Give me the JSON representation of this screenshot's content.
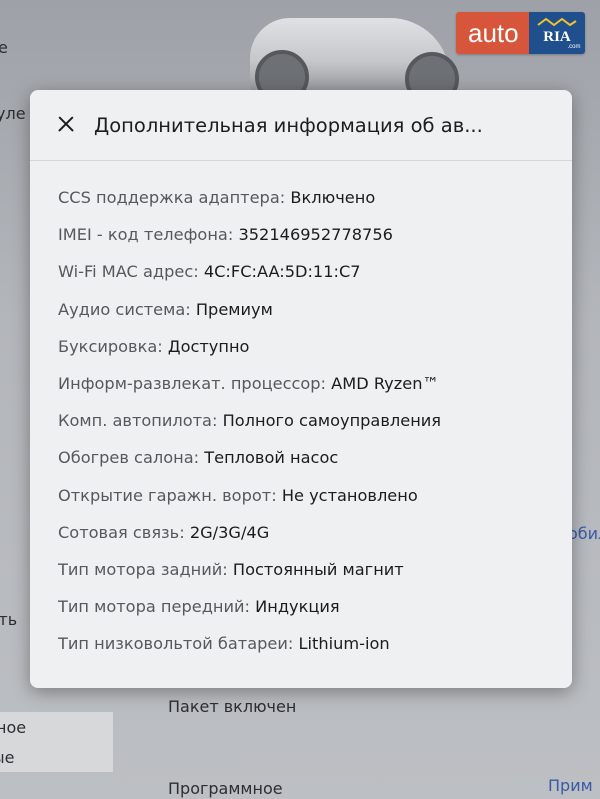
{
  "background": {
    "left_fragments": [
      "е",
      "уле",
      "ить",
      "ное",
      "ые"
    ],
    "right_fragments": [
      "обил",
      "Прим"
    ],
    "bottom_texts": [
      "Пакет включен",
      "Программное"
    ]
  },
  "logo": {
    "auto_text": "auto",
    "ria_text": "RIA",
    "ria_domain": ".com"
  },
  "modal": {
    "title": "Дополнительная информация об ав...",
    "rows": [
      {
        "label": "CCS поддержка адаптера:",
        "value": "Включено"
      },
      {
        "label": "IMEI - код телефона:",
        "value": "352146952778756"
      },
      {
        "label": "Wi-Fi MAC адрес:",
        "value": "4C:FC:AA:5D:11:C7"
      },
      {
        "label": "Аудио система:",
        "value": "Премиум"
      },
      {
        "label": "Буксировка:",
        "value": "Доступно"
      },
      {
        "label": "Информ-развлекат. процессор:",
        "value": "AMD Ryzen™"
      },
      {
        "label": "Комп. автопилота:",
        "value": "Полного самоуправления"
      },
      {
        "label": "Обогрев салона:",
        "value": "Тепловой насос"
      },
      {
        "label": "Открытие гаражн. ворот:",
        "value": "Не установлено"
      },
      {
        "label": "Сотовая связь:",
        "value": "2G/3G/4G"
      },
      {
        "label": "Тип мотора задний:",
        "value": "Постоянный магнит"
      },
      {
        "label": "Тип мотора передний:",
        "value": "Индукция"
      },
      {
        "label": "Тип низковольтой батареи:",
        "value": "Lithium-ion"
      }
    ]
  },
  "colors": {
    "modal_bg": "#eff0f1",
    "label": "#55585d",
    "value": "#1b1c1e",
    "logo_auto": "#d7563b",
    "logo_ria": "#1f4f8c"
  },
  "icons": {
    "close": "close-icon",
    "logo": "autoria-logo"
  }
}
